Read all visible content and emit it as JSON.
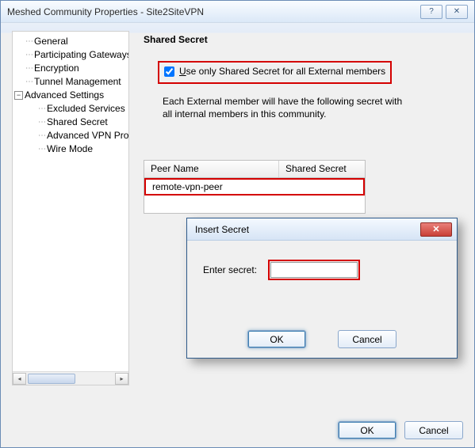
{
  "window": {
    "title": "Meshed Community Properties - Site2SiteVPN"
  },
  "tree": {
    "general": "General",
    "gateways": "Participating Gateways",
    "encryption": "Encryption",
    "tunnel": "Tunnel Management",
    "advanced": "Advanced Settings",
    "excluded": "Excluded Services",
    "shared": "Shared Secret",
    "advvpn": "Advanced VPN Pro",
    "wire": "Wire Mode"
  },
  "content": {
    "title": "Shared Secret",
    "checkbox_prefix": "U",
    "checkbox_rest": "se only Shared Secret for all External members",
    "desc": "Each External member will have the following secret with all internal members in this community.",
    "col_peer": "Peer Name",
    "col_secret": "Shared Secret",
    "row_peer": "remote-vpn-peer"
  },
  "modal": {
    "title": "Insert Secret",
    "label": "Enter secret:",
    "ok": "OK",
    "cancel": "Cancel"
  },
  "buttons": {
    "ok": "OK",
    "cancel": "Cancel"
  }
}
